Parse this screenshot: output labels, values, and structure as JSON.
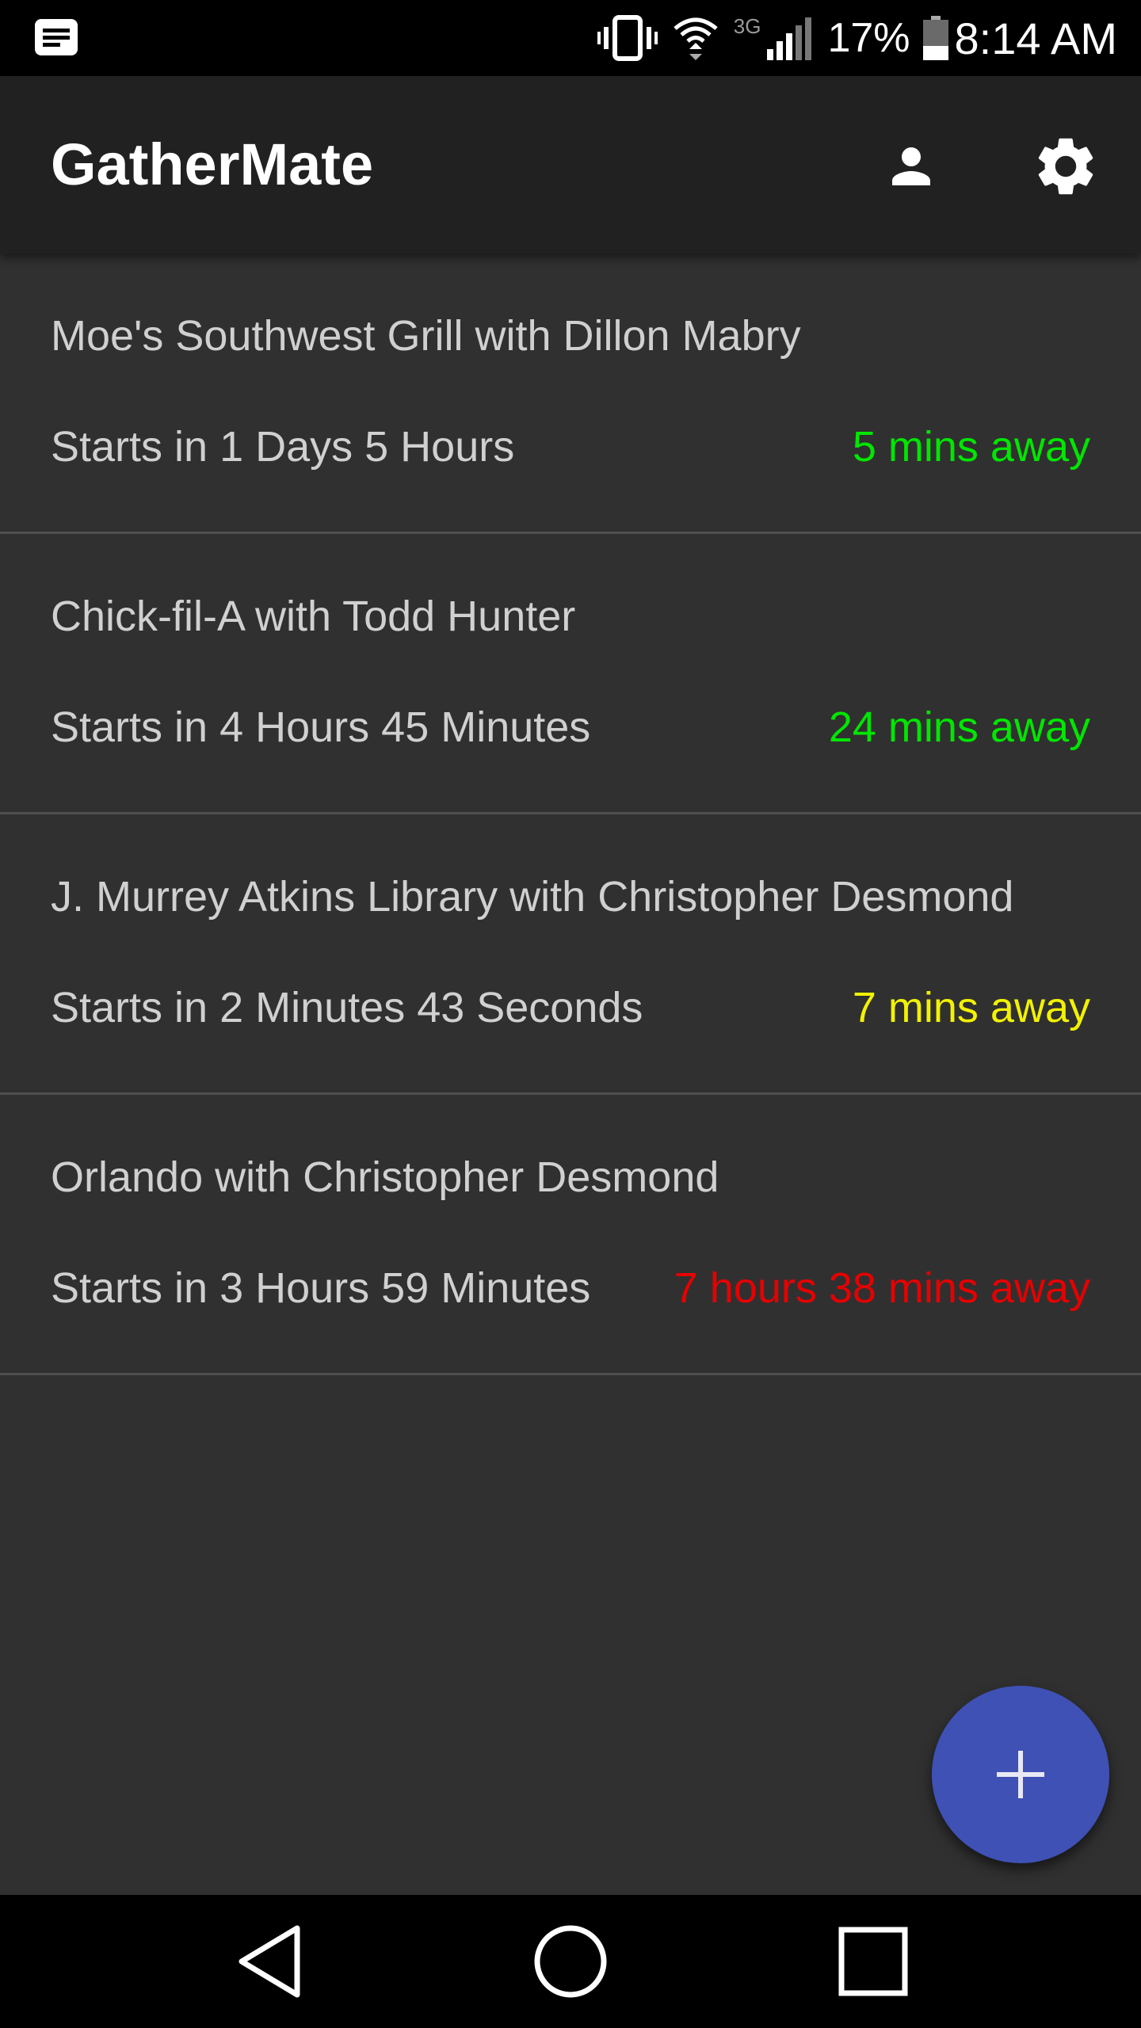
{
  "status_bar": {
    "battery_percent": "17%",
    "time": "8:14 AM",
    "network_label": "3G",
    "icons": [
      "notification-message-icon",
      "vibrate-icon",
      "wifi-icon",
      "network-3g-icon",
      "signal-icon",
      "battery-icon"
    ]
  },
  "app_bar": {
    "title": "GatherMate",
    "actions": [
      "profile-icon",
      "settings-gear-icon"
    ]
  },
  "meetings": [
    {
      "title": "Moe's Southwest Grill with Dillon Mabry",
      "starts": "Starts in 1 Days 5 Hours",
      "distance": "5 mins away",
      "distance_color": "#00e600"
    },
    {
      "title": "Chick-fil-A with Todd Hunter",
      "starts": "Starts in 4 Hours 45 Minutes",
      "distance": "24 mins away",
      "distance_color": "#00e600"
    },
    {
      "title": "J. Murrey Atkins Library with Christopher Desmond",
      "starts": "Starts in 2 Minutes 43 Seconds",
      "distance": "7 mins away",
      "distance_color": "#f2f200"
    },
    {
      "title": "Orlando with Christopher Desmond",
      "starts": "Starts in 3 Hours 59 Minutes",
      "distance": "7 hours 38 mins away",
      "distance_color": "#e60000"
    }
  ],
  "fab": {
    "icon": "plus-icon",
    "color": "#3f51b5"
  },
  "nav_bar": {
    "buttons": [
      "back-icon",
      "home-icon",
      "recents-icon"
    ]
  }
}
